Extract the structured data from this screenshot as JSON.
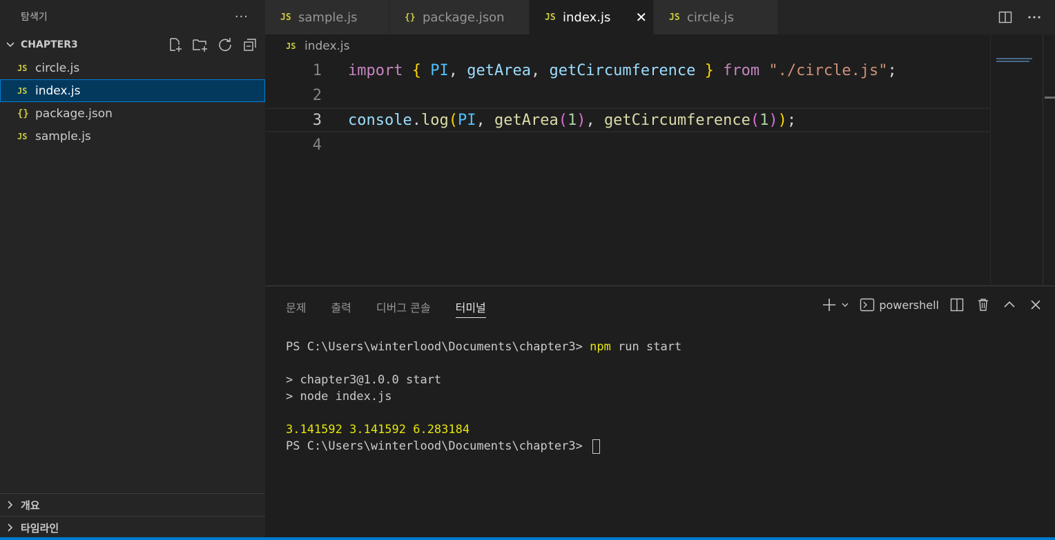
{
  "sidebar": {
    "title": "탐색기",
    "more": "···",
    "folder": "CHAPTER3",
    "items": [
      {
        "icon": "JS",
        "label": "circle.js"
      },
      {
        "icon": "JS",
        "label": "index.js"
      },
      {
        "icon": "{}",
        "label": "package.json"
      },
      {
        "icon": "JS",
        "label": "sample.js"
      }
    ],
    "outline": "개요",
    "timeline": "타임라인"
  },
  "tabs": [
    {
      "icon": "JS",
      "label": "sample.js"
    },
    {
      "icon": "{}",
      "label": "package.json"
    },
    {
      "icon": "JS",
      "label": "index.js",
      "close": "✕"
    },
    {
      "icon": "JS",
      "label": "circle.js"
    }
  ],
  "breadcrumb": {
    "icon": "JS",
    "label": "index.js"
  },
  "editor": {
    "line_numbers": [
      "1",
      "2",
      "3",
      "4"
    ],
    "lines": [
      {
        "import": "import",
        "brace_open": "{",
        "pi": "PI",
        "c1": ",",
        "getArea": "getArea",
        "c2": ",",
        "getCirc": "getCircumference",
        "brace_close": "}",
        "from": "from",
        "path": "\"./circle.js\"",
        "semi": ";"
      },
      {},
      {
        "console": "console",
        "dot": ".",
        "log": "log",
        "p_open": "(",
        "pi": "PI",
        "c1": ",",
        "getArea": "getArea",
        "p2_open": "(",
        "one_a": "1",
        "p2_close": ")",
        "c2": ",",
        "getCirc": "getCircumference",
        "p3_open": "(",
        "one_b": "1",
        "p3_close": ")",
        "p_close": ")",
        "semi": ";"
      }
    ]
  },
  "panel": {
    "tabs": [
      "문제",
      "출력",
      "디버그 콘솔",
      "터미널"
    ],
    "shell_label": "powershell",
    "terminal": {
      "prompt1": "PS C:\\Users\\winterlood\\Documents\\chapter3> ",
      "cmd_npm": "npm",
      "cmd_rest": " run start",
      "out1": "> chapter3@1.0.0 start",
      "out2": "> node index.js",
      "result": "3.141592 3.141592 6.283184",
      "prompt2": "PS C:\\Users\\winterlood\\Documents\\chapter3> "
    }
  },
  "colors": {
    "accent": "#007acc",
    "selection": "#04395e",
    "keyword": "#c586c0",
    "function": "#dcdcaa",
    "string": "#ce9178"
  }
}
